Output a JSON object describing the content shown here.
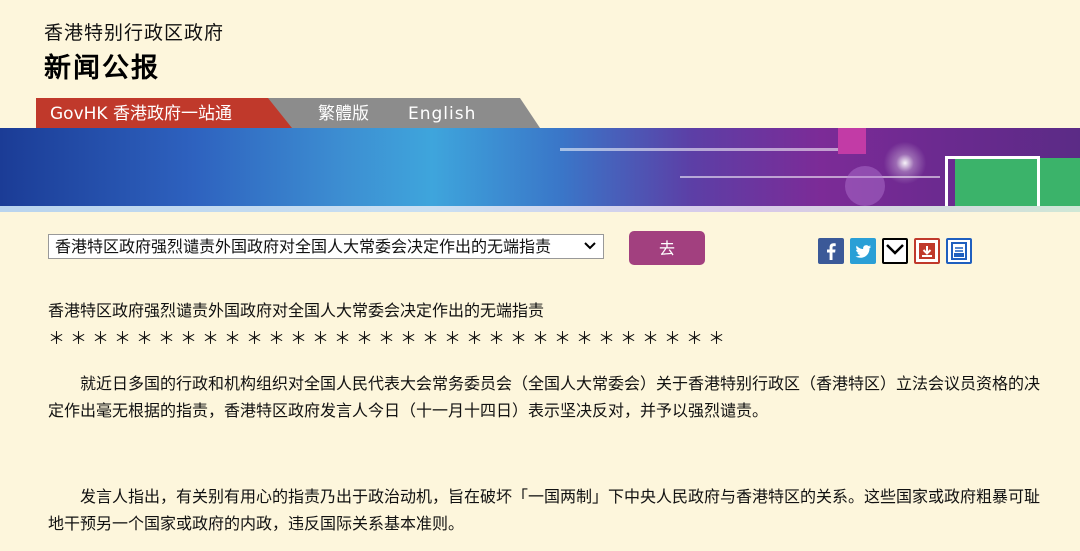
{
  "header": {
    "department": "香港特别行政区政府",
    "page_title": "新闻公报"
  },
  "tabs": {
    "govhk": "GovHK 香港政府一站通",
    "traditional": "繁體版",
    "english": "English"
  },
  "colors": {
    "background": "#fdf6dc",
    "govhk_tab": "#c0392b",
    "lang_tab": "#8c8c8c",
    "go_button": "#a2407f"
  },
  "nav": {
    "selected_article": "香港特区政府强烈谴责外国政府对全国人大常委会决定作出的无端指责",
    "go_label": "去"
  },
  "share_icons": [
    "facebook-icon",
    "twitter-icon",
    "email-icon",
    "save-icon",
    "print-icon"
  ],
  "article": {
    "title": "香港特区政府强烈谴责外国政府对全国人大常委会决定作出的无端指责",
    "separator": "＊＊＊＊＊＊＊＊＊＊＊＊＊＊＊＊＊＊＊＊＊＊＊＊＊＊＊＊＊＊＊",
    "paragraphs": [
      "　　就近日多国的行政和机构组织对全国人民代表大会常务委员会（全国人大常委会）关于香港特别行政区（香港特区）立法会议员资格的决定作出毫无根据的指责，香港特区政府发言人今日（十一月十四日）表示坚决反对，并予以强烈谴责。",
      "　　发言人指出，有关别有用心的指责乃出于政治动机，旨在破坏「一国两制」下中央人民政府与香港特区的关系。这些国家或政府粗暴可耻地干预另一个国家或政府的内政，违反国际关系基本准则。"
    ]
  }
}
